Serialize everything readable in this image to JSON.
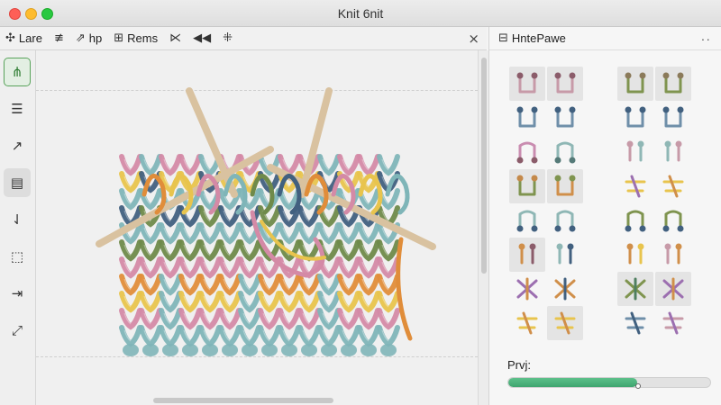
{
  "window": {
    "title": "Knit 6nit"
  },
  "toolbar": {
    "items": [
      {
        "icon": "✣",
        "label": "Lare"
      },
      {
        "icon": "≢",
        "label": ""
      },
      {
        "icon": "⇗",
        "label": "hp"
      },
      {
        "icon": "⊞",
        "label": "Rems"
      },
      {
        "icon": "⋉",
        "label": ""
      },
      {
        "icon": "◀◀",
        "label": ""
      },
      {
        "icon": "⁜",
        "label": ""
      }
    ],
    "close_icon": "×"
  },
  "rail": {
    "tools": [
      {
        "icon": "⋔",
        "name": "stitch-tool-icon"
      },
      {
        "icon": "☰",
        "name": "list-tool-icon"
      },
      {
        "icon": "↗",
        "name": "arrow-tool-icon"
      },
      {
        "icon": "▤",
        "name": "pattern-tool-icon"
      },
      {
        "icon": "⇃",
        "name": "bracket-tool-icon"
      },
      {
        "icon": "⬚",
        "name": "select-tool-icon"
      },
      {
        "icon": "⇥",
        "name": "export-tool-icon"
      },
      {
        "icon": "⤢",
        "name": "resize-tool-icon"
      }
    ],
    "active_index": 0,
    "selected_index": 3
  },
  "panel": {
    "title": "HntePawe",
    "title_icon": "⊟",
    "more_icon": "··",
    "progress_label": "Prvj:",
    "progress_value": 0.64
  },
  "colors": {
    "accent_green": "#3ea56f",
    "yarn_pink": "#d48aa6",
    "yarn_yellow": "#e8c44d",
    "yarn_teal": "#7fb5b8",
    "yarn_navy": "#41607f",
    "yarn_olive": "#6f8a4a",
    "yarn_orange": "#e08d3a"
  }
}
